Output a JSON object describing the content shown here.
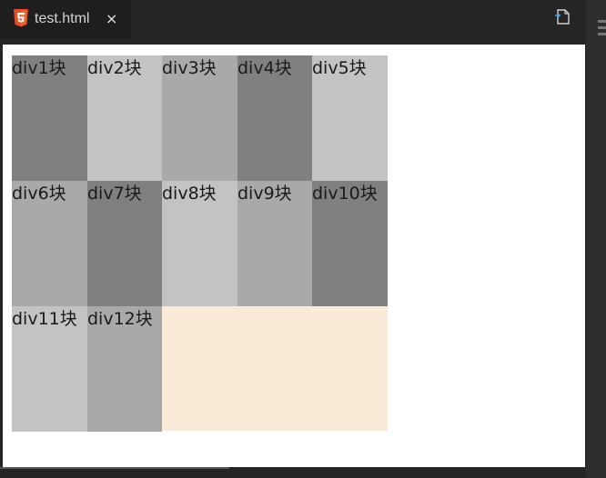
{
  "tab": {
    "title": "test.html",
    "close_symbol": "×",
    "icon": "html5-icon"
  },
  "toolbar": {
    "open_preview_icon": "open-in-browser-icon"
  },
  "colors": {
    "dark": "#808080",
    "light": "#c3c3c3",
    "mid": "#a9a9a9",
    "container": "#faebd7"
  },
  "blocks": [
    {
      "label": "div1块",
      "color": "#808080"
    },
    {
      "label": "div2块",
      "color": "#c3c3c3"
    },
    {
      "label": "div3块",
      "color": "#a9a9a9"
    },
    {
      "label": "div4块",
      "color": "#808080"
    },
    {
      "label": "div5块",
      "color": "#c3c3c3"
    },
    {
      "label": "div6块",
      "color": "#a9a9a9"
    },
    {
      "label": "div7块",
      "color": "#808080"
    },
    {
      "label": "div8块",
      "color": "#c3c3c3"
    },
    {
      "label": "div9块",
      "color": "#a9a9a9"
    },
    {
      "label": "div10块",
      "color": "#808080"
    },
    {
      "label": "div11块",
      "color": "#c3c3c3"
    },
    {
      "label": "div12块",
      "color": "#a9a9a9"
    }
  ]
}
